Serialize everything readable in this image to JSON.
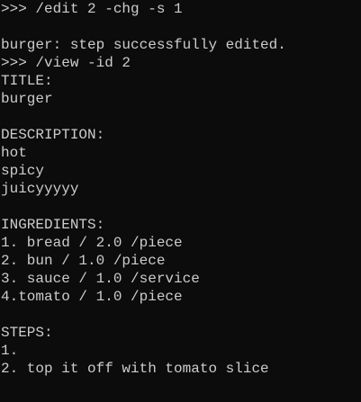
{
  "terminal": {
    "background": "#0c0c0c",
    "foreground": "#cccccc",
    "lines": [
      ">>> /edit 2 -chg -s 1",
      "",
      "burger: step successfully edited.",
      ">>> /view -id 2",
      "TITLE:",
      "burger",
      "",
      "DESCRIPTION:",
      "hot",
      "spicy",
      "juicyyyyy",
      "",
      "INGREDIENTS:",
      "1. bread / 2.0 /piece",
      "2. bun / 1.0 /piece",
      "3. sauce / 1.0 /service",
      "4.tomato / 1.0 /piece",
      "",
      "STEPS:",
      "1.",
      "2. top it off with tomato slice"
    ]
  }
}
